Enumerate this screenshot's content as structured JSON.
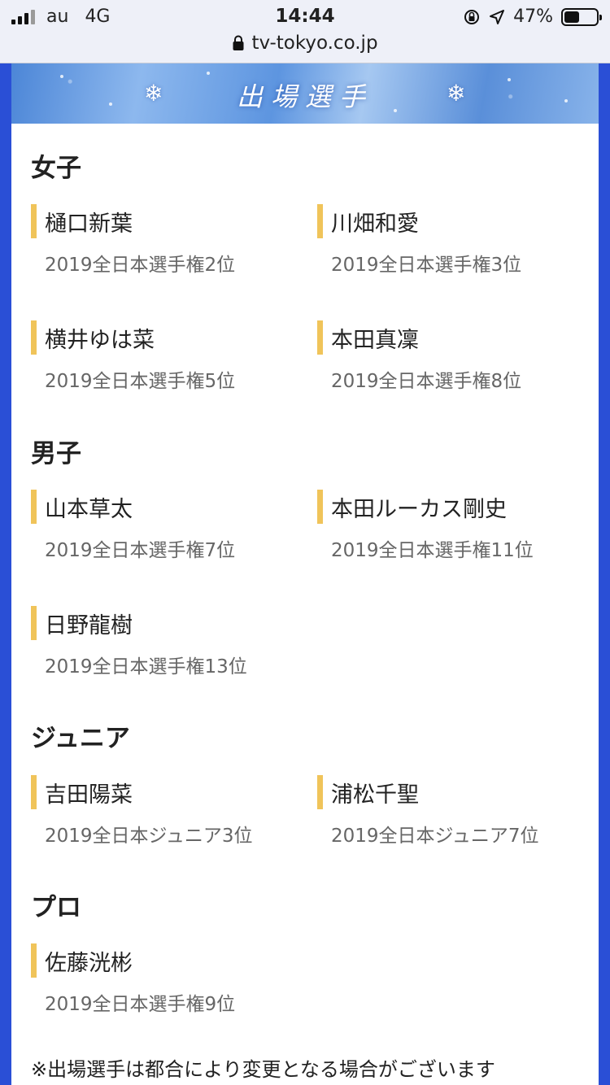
{
  "status_bar": {
    "carrier": "au",
    "network": "4G",
    "time": "14:44",
    "battery": "47%",
    "battery_level": 0.47,
    "url": "tv-tokyo.co.jp"
  },
  "banner": {
    "title": "出場選手"
  },
  "sections": {
    "women": {
      "title": "女子",
      "entries": [
        {
          "name": "樋口新葉",
          "rank": "2019全日本選手権2位"
        },
        {
          "name": "川畑和愛",
          "rank": "2019全日本選手権3位"
        },
        {
          "name": "横井ゆは菜",
          "rank": "2019全日本選手権5位"
        },
        {
          "name": "本田真凜",
          "rank": "2019全日本選手権8位"
        }
      ]
    },
    "men": {
      "title": "男子",
      "entries": [
        {
          "name": "山本草太",
          "rank": "2019全日本選手権7位"
        },
        {
          "name": "本田ルーカス剛史",
          "rank": "2019全日本選手権11位"
        },
        {
          "name": "日野龍樹",
          "rank": "2019全日本選手権13位"
        }
      ]
    },
    "junior": {
      "title": "ジュニア",
      "entries": [
        {
          "name": "吉田陽菜",
          "rank": "2019全日本ジュニア3位"
        },
        {
          "name": "浦松千聖",
          "rank": "2019全日本ジュニア7位"
        }
      ]
    },
    "pro": {
      "title": "プロ",
      "entries": [
        {
          "name": "佐藤洸彬",
          "rank": "2019全日本選手権9位"
        }
      ]
    }
  },
  "note": "※出場選手は都合により変更となる場合がございます"
}
